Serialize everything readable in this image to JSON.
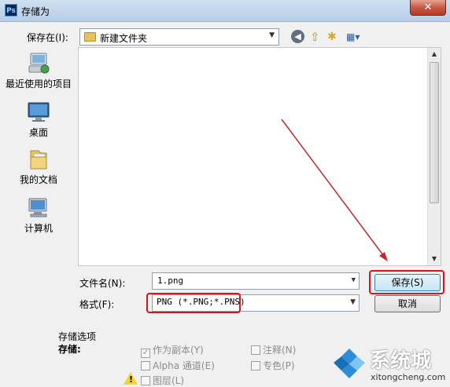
{
  "window": {
    "title": "存储为",
    "app_icon": "Ps",
    "close_label": "✕"
  },
  "toolbar": {
    "save_in_label": "保存在(I):",
    "folder": "新建文件夹",
    "icons": [
      "back-icon",
      "up-folder-icon",
      "new-folder-icon",
      "view-menu-icon"
    ]
  },
  "places": [
    {
      "label": "最近使用的项目",
      "icon": "recent-items-icon"
    },
    {
      "label": "桌面",
      "icon": "desktop-icon"
    },
    {
      "label": "我的文档",
      "icon": "documents-icon"
    },
    {
      "label": "计算机",
      "icon": "computer-icon"
    }
  ],
  "form": {
    "filename_label": "文件名(N):",
    "filename_value": "1.png",
    "format_label": "格式(F):",
    "format_value": "PNG (*.PNG;*.PNS)",
    "save_button": "保存(S)",
    "cancel_button": "取消"
  },
  "options": {
    "section_label": "存储选项",
    "store_label": "存储:",
    "as_copy": "作为副本(Y)",
    "alpha": "Alpha 通道(E)",
    "layers": "图层(L)",
    "annotations": "注释(N)",
    "spot": "专色(P)"
  },
  "watermark": {
    "brand": "系统城",
    "url": "xitongcheng.com"
  },
  "colors": {
    "highlight_box": "#d4161c",
    "arrow": "#c0282e",
    "titlebar": "#c3d6ec"
  }
}
